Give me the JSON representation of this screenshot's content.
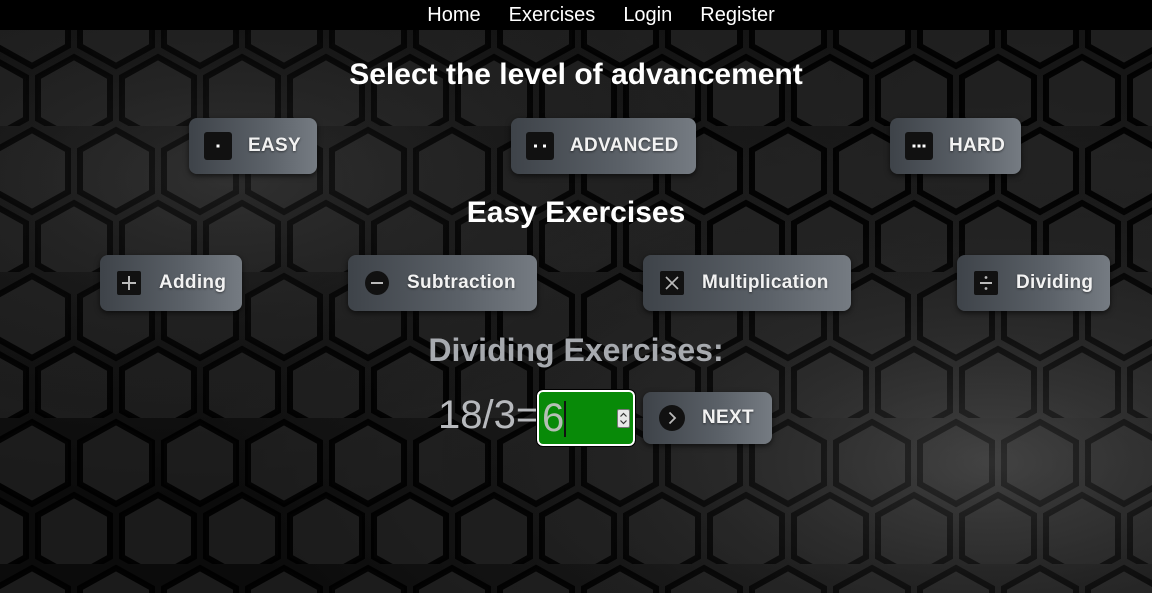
{
  "nav": {
    "items": [
      "Home",
      "Exercises",
      "Login",
      "Register"
    ]
  },
  "level_section": {
    "title": "Select the level of advancement",
    "buttons": [
      {
        "label": "EASY",
        "icon": "one-dot-icon"
      },
      {
        "label": "ADVANCED",
        "icon": "two-dots-icon"
      },
      {
        "label": "HARD",
        "icon": "three-dots-icon"
      }
    ]
  },
  "exercises_section": {
    "title": "Easy Exercises",
    "buttons": [
      {
        "label": "Adding",
        "icon": "plus-icon"
      },
      {
        "label": "Subtraction",
        "icon": "minus-icon"
      },
      {
        "label": "Multiplication",
        "icon": "multiply-icon"
      },
      {
        "label": "Dividing",
        "icon": "divide-icon"
      }
    ]
  },
  "task": {
    "title": "Dividing Exercises:",
    "equation": "18/3=",
    "answer_value": "6",
    "next_label": "NEXT",
    "next_icon": "chevron-right-icon"
  },
  "colors": {
    "answer_bg": "#088a08",
    "navbar_bg": "#000000",
    "button_gradient_start": "#3e4349",
    "button_gradient_end": "#757b82"
  }
}
